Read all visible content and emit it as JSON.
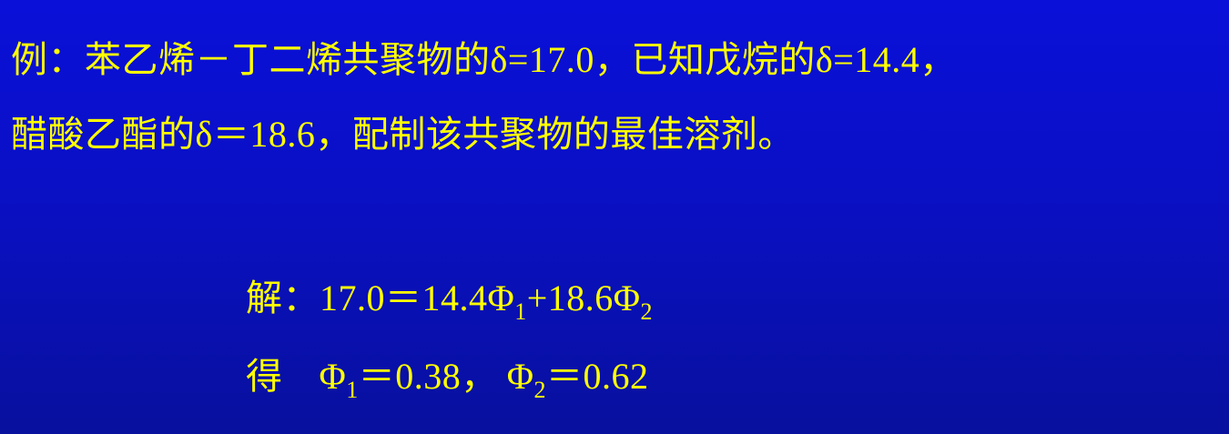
{
  "problem": {
    "line1": "例：苯乙烯－丁二烯共聚物的δ=17.0，已知戊烷的δ=14.4，",
    "line2": "醋酸乙酯的δ＝18.6，配制该共聚物的最佳溶剂。"
  },
  "solution": {
    "label_solve": "解：",
    "equation_part1": "17.0＝14.4Φ",
    "sub1": "1",
    "equation_part2": "+18.6Φ",
    "sub2": "2",
    "label_result": "得",
    "result_phi": "Φ",
    "result_sub1": "1",
    "result_value1": "＝0.38，",
    "result_sub2": "2",
    "result_value2": "＝0.62"
  }
}
